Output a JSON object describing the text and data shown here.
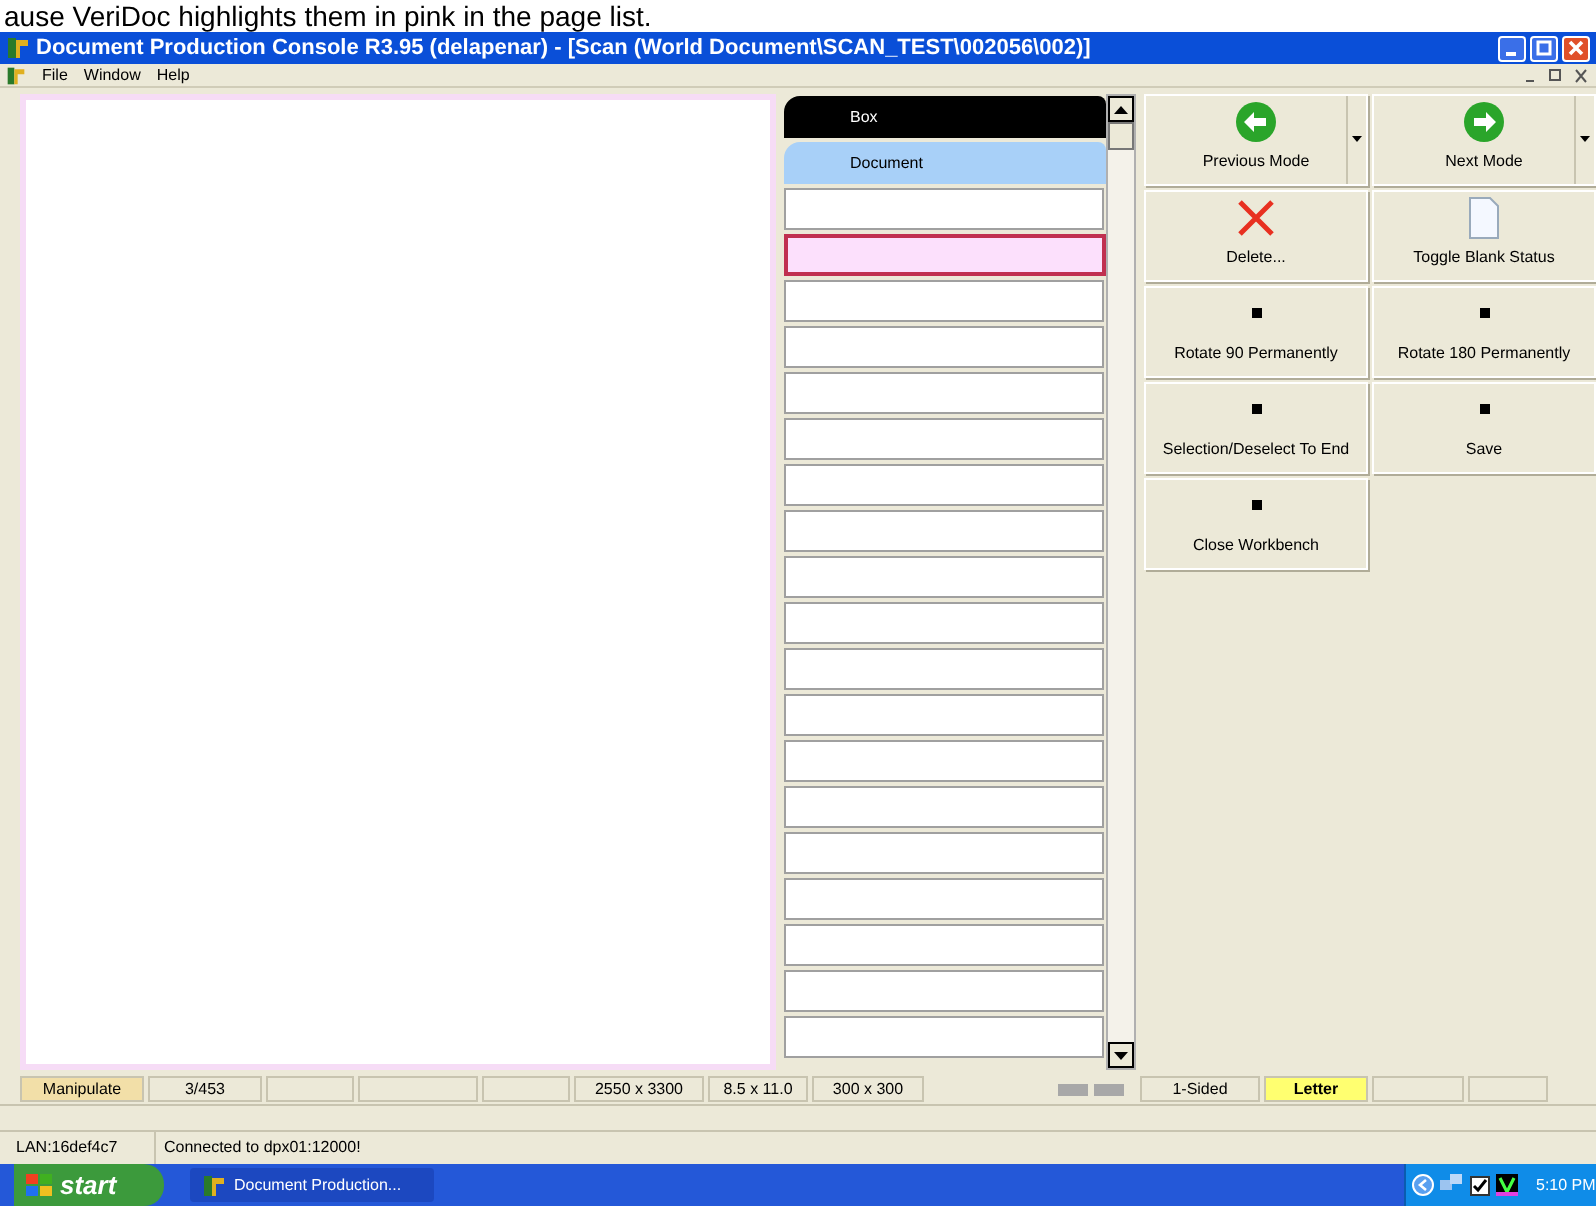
{
  "caption": "ause VeriDoc highlights them in pink in the page list.",
  "window": {
    "title": "Document Production Console R3.95 (delapenar) - [Scan (World Document\\SCAN_TEST\\002056\\002)]"
  },
  "menu": [
    "File",
    "Window",
    "Help"
  ],
  "page_list": {
    "headers": [
      {
        "label": "Box",
        "kind": "box"
      },
      {
        "label": "Document",
        "kind": "document"
      }
    ],
    "pages": [
      {
        "selected": false
      },
      {
        "selected": true
      },
      {
        "selected": false
      },
      {
        "selected": false
      },
      {
        "selected": false
      },
      {
        "selected": false
      },
      {
        "selected": false
      },
      {
        "selected": false
      },
      {
        "selected": false
      },
      {
        "selected": false
      },
      {
        "selected": false
      },
      {
        "selected": false
      },
      {
        "selected": false
      },
      {
        "selected": false
      },
      {
        "selected": false
      },
      {
        "selected": false
      },
      {
        "selected": false
      },
      {
        "selected": false
      },
      {
        "selected": false
      }
    ]
  },
  "actions": [
    {
      "label": "Previous Mode",
      "kind": "back",
      "dropdown": true
    },
    {
      "label": "Next Mode",
      "kind": "forward",
      "dropdown": true
    },
    {
      "label": "Delete...",
      "kind": "delete"
    },
    {
      "label": "Toggle Blank Status",
      "kind": "page"
    },
    {
      "label": "Rotate 90 Permanently",
      "kind": "dot"
    },
    {
      "label": "Rotate 180 Permanently",
      "kind": "dot"
    },
    {
      "label": "Selection/Deselect To End",
      "kind": "dot"
    },
    {
      "label": "Save",
      "kind": "dot"
    },
    {
      "label": "Close Workbench",
      "kind": "dot"
    }
  ],
  "status_bar": [
    {
      "text": "Manipulate",
      "kind": "mode"
    },
    {
      "text": "3/453"
    },
    {
      "kind": "blank"
    },
    {
      "kind": "blank"
    },
    {
      "kind": "blank"
    },
    {
      "text": "2550 x 3300"
    },
    {
      "text": "8.5 x 11.0"
    },
    {
      "text": "300 x 300"
    },
    {
      "kind": "icons"
    },
    {
      "text": "1-Sided"
    },
    {
      "text": "Letter",
      "kind": "highlight"
    },
    {
      "kind": "blank"
    },
    {
      "kind": "blank"
    }
  ],
  "connection": {
    "lan": "LAN:16def4c7",
    "message": "Connected to dpx01:12000!"
  },
  "taskbar": {
    "start": "start",
    "task": "Document Production...",
    "clock": "5:10 PM"
  }
}
